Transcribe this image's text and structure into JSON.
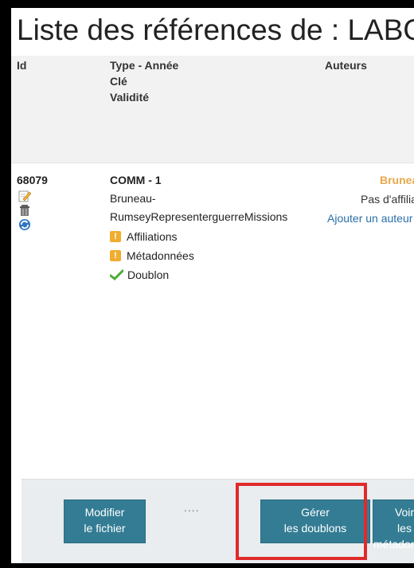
{
  "page": {
    "title": "Liste des références de : LABO"
  },
  "table": {
    "headers": {
      "id": "Id",
      "type_lines": [
        "Type - Année",
        "Clé",
        "Validité"
      ],
      "authors": "Auteurs"
    },
    "row": {
      "id": "68079",
      "type_year": "COMM - 1",
      "key_line1": "Bruneau-",
      "key_line2": "RumseyRepresenterguerreMissions",
      "statuses": [
        {
          "label": "Affiliations",
          "icon": "warning-icon"
        },
        {
          "label": "Métadonnées",
          "icon": "warning-icon"
        },
        {
          "label": "Doublon",
          "icon": "checkmark-icon"
        }
      ],
      "author_name": "Bruneau",
      "author_note": "Pas d'affiliation",
      "add_author": "Ajouter un auteur"
    }
  },
  "footer": {
    "modify": [
      "Modifier",
      "le fichier"
    ],
    "dots": "....",
    "manage_duplicates": [
      "Gérer",
      "les doublons"
    ],
    "view_metadata": [
      "Voir",
      "les métadonnées"
    ]
  },
  "colors": {
    "button": "#337c94",
    "warning": "#f0ad2f",
    "highlight": "#e02a2a",
    "link": "#2a6fa8",
    "author": "#e8a94a"
  }
}
